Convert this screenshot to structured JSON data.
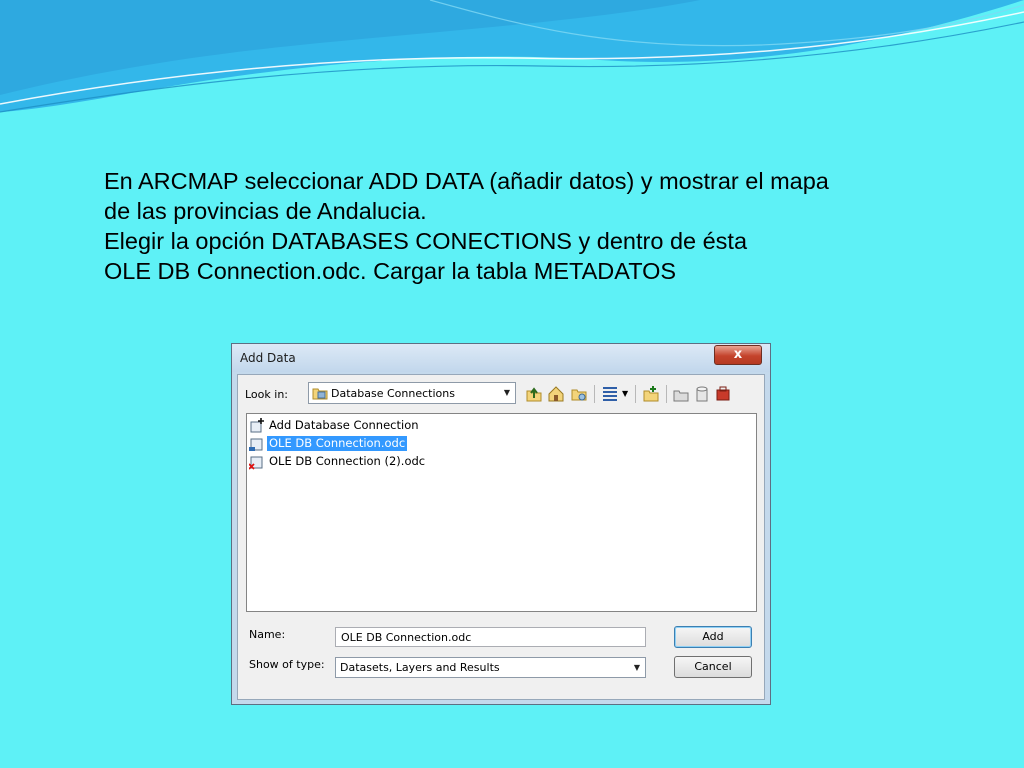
{
  "slide": {
    "lines": [
      "En ARCMAP seleccionar ADD DATA (añadir datos) y mostrar el mapa",
      "de las provincias de Andalucia.",
      "Elegir la opción DATABASES CONECTIONS y dentro de ésta",
      "OLE DB Connection.odc. Cargar la tabla METADATOS"
    ]
  },
  "dialog": {
    "title": "Add Data",
    "close_label": "x",
    "look_in_label": "Look in:",
    "look_in_value": "Database Connections",
    "files": [
      {
        "name": "Add Database Connection",
        "icon": "add-connection-icon",
        "selected": false
      },
      {
        "name": "OLE DB Connection.odc",
        "icon": "ole-db-connection-icon",
        "selected": true
      },
      {
        "name": "OLE DB Connection (2).odc",
        "icon": "ole-db-connection-error-icon",
        "selected": false
      }
    ],
    "name_label": "Name:",
    "name_value": "OLE DB Connection.odc",
    "type_label": "Show of type:",
    "type_value": "Datasets, Layers and Results",
    "add_label": "Add",
    "cancel_label": "Cancel"
  },
  "colors": {
    "background": "#5ef1f6",
    "selection": "#3399ff",
    "close_button": "#c4432c"
  }
}
